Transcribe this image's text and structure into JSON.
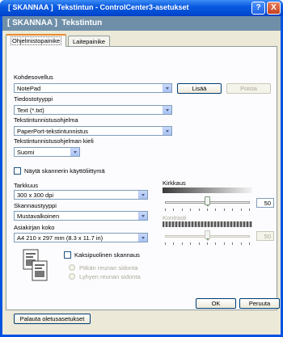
{
  "window": {
    "title": "[ SKANNAA ]  Tekstintun - ControlCenter3-asetukset",
    "help_label": "?",
    "close_label": "X"
  },
  "header": {
    "title": "[ SKANNAA ]  Tekstintun"
  },
  "tabs": [
    {
      "label": "Ohjelmistopainike",
      "active": true
    },
    {
      "label": "Laitepainike",
      "active": false
    }
  ],
  "target_app": {
    "label": "Kohdesovellus",
    "value": "NotePad",
    "add_label": "Lisää",
    "remove_label": "Poista"
  },
  "file_type": {
    "label": "Tiedostotyyppi",
    "value": "Text (*.txt)"
  },
  "ocr_program": {
    "label": "Tekstintunnistusohjelma",
    "value": "PaperPort-tekstintunnistus"
  },
  "ocr_language": {
    "label": "Tekstintunnistusohjelman kieli",
    "value": "Suomi"
  },
  "show_ui": {
    "label": "Näytä skannerin käyttöliittymä",
    "checked": false
  },
  "resolution": {
    "label": "Tarkkuus",
    "value": "300 x 300 dpi"
  },
  "scan_type": {
    "label": "Skannaustyyppi",
    "value": "Mustavalkoinen"
  },
  "doc_size": {
    "label": "Asiakirjan koko",
    "value": "A4 210 x 297 mm (8.3 x 11.7 in)"
  },
  "brightness": {
    "label": "Kirkkaus",
    "value": "50",
    "level": 0.5
  },
  "contrast": {
    "label": "Kontrasti",
    "value": "50",
    "level": 0.5,
    "enabled": false
  },
  "duplex": {
    "label": "Kaksipuolinen skannaus",
    "checked": false,
    "long_edge": "Pitkän reunan sidonta",
    "short_edge": "Lyhyen reunan sidonta"
  },
  "restore_label": "Palauta oletusasetukset",
  "ok_label": "OK",
  "cancel_label": "Peruuta",
  "colors": {
    "title_blue": "#0053e1",
    "header_band": "#6f8fa9",
    "dialog_bg": "#ece9d8",
    "tab_accent": "#e68b2c"
  }
}
